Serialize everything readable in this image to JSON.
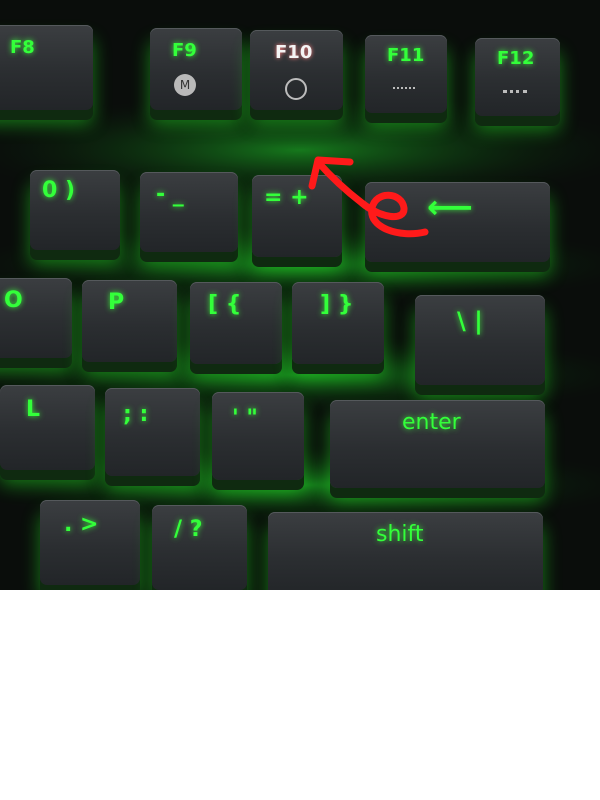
{
  "keyboard": {
    "row_fn": [
      {
        "id": "f8",
        "label": "F8"
      },
      {
        "id": "f9",
        "label": "F9",
        "icon": "macro-icon",
        "icon_text": "M"
      },
      {
        "id": "f10",
        "label": "F10",
        "icon": "gaming-mode-icon",
        "highlighted": true
      },
      {
        "id": "f11",
        "label": "F11",
        "icon": "brightness-down-icon"
      },
      {
        "id": "f12",
        "label": "F12",
        "icon": "brightness-up-icon"
      }
    ],
    "row_num": [
      {
        "id": "zero",
        "label": "0 )"
      },
      {
        "id": "minus",
        "label": "- _"
      },
      {
        "id": "equals",
        "label": "= +"
      },
      {
        "id": "backspace",
        "label": "⟵"
      }
    ],
    "row_top": [
      {
        "id": "o",
        "label": "O"
      },
      {
        "id": "p",
        "label": "P"
      },
      {
        "id": "lbracket",
        "label": "[ {"
      },
      {
        "id": "rbracket",
        "label": "] }"
      },
      {
        "id": "backslash",
        "label": "\\ |"
      }
    ],
    "row_home": [
      {
        "id": "l",
        "label": "L"
      },
      {
        "id": "semicolon",
        "label": "; :"
      },
      {
        "id": "quote",
        "label": "' \""
      },
      {
        "id": "enter",
        "label": "enter"
      }
    ],
    "row_bottom": [
      {
        "id": "period",
        "label": ". >"
      },
      {
        "id": "slash",
        "label": "/ ?"
      },
      {
        "id": "shift",
        "label": "shift"
      }
    ]
  },
  "colors": {
    "backlight": "#33ff3a",
    "keycap": "#2e3134",
    "annotation": "#ff1a1a",
    "f10_label": "#f4f4f4"
  }
}
